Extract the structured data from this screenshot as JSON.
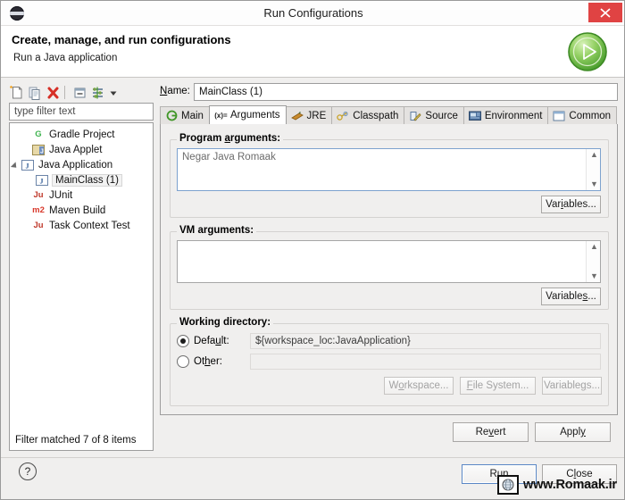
{
  "window": {
    "title": "Run Configurations",
    "app_icon": "eclipse-icon",
    "close_label": "×"
  },
  "header": {
    "title": "Create, manage, and run configurations",
    "subtitle": "Run a Java application",
    "badge_icon": "run-green-play-icon"
  },
  "left_panel": {
    "toolbar": [
      {
        "name": "new-configuration",
        "icon": "new-document-icon"
      },
      {
        "name": "duplicate-configuration",
        "icon": "copy-icon"
      },
      {
        "name": "delete-configuration",
        "icon": "delete-red-x-icon"
      },
      {
        "name": "collapse-all",
        "icon": "collapse-all-icon"
      },
      {
        "name": "filter-configurations",
        "icon": "filter-icon"
      },
      {
        "name": "view-menu",
        "icon": "chevron-down-icon"
      }
    ],
    "filter": {
      "placeholder": "type filter text",
      "value": ""
    },
    "tree": [
      {
        "label": "Gradle Project",
        "icon": "gradle-icon",
        "icon_text": "G",
        "icon_color": "#3fb34f",
        "indent": 12,
        "expandable": false,
        "selected": false
      },
      {
        "label": "Java Applet",
        "icon": "java-applet-icon",
        "icon_text": "J",
        "icon_color": "#c08a2a",
        "indent": 12,
        "expandable": false,
        "selected": false
      },
      {
        "label": "Java Application",
        "icon": "java-app-icon",
        "icon_text": "J",
        "icon_color": "#3a6fb0",
        "indent": 0,
        "expandable": true,
        "selected": false
      },
      {
        "label": "MainClass (1)",
        "icon": "java-app-icon",
        "icon_text": "J",
        "icon_color": "#3a6fb0",
        "indent": 28,
        "expandable": false,
        "selected": true
      },
      {
        "label": "JUnit",
        "icon": "junit-icon",
        "icon_text": "Ju",
        "icon_color": "#c0392b",
        "indent": 12,
        "expandable": false,
        "selected": false
      },
      {
        "label": "Maven Build",
        "icon": "maven-icon",
        "icon_text": "m2",
        "icon_color": "#d8382b",
        "indent": 12,
        "expandable": false,
        "selected": false
      },
      {
        "label": "Task Context Test",
        "icon": "task-context-icon",
        "icon_text": "Ju",
        "icon_color": "#c0392b",
        "indent": 12,
        "expandable": false,
        "selected": false
      }
    ],
    "status": "Filter matched 7 of 8 items"
  },
  "right_panel": {
    "name_label": "Name:",
    "name_label_mnemonic": "N",
    "name_value": "MainClass (1)",
    "tabs": [
      {
        "label": "Main",
        "icon": "main-green-circle-icon",
        "active": false
      },
      {
        "label": "Arguments",
        "icon": "arguments-xy-icon",
        "active": true
      },
      {
        "label": "JRE",
        "icon": "jre-icon",
        "active": false
      },
      {
        "label": "Classpath",
        "icon": "classpath-icon",
        "active": false
      },
      {
        "label": "Source",
        "icon": "source-icon",
        "active": false
      },
      {
        "label": "Environment",
        "icon": "environment-icon",
        "active": false
      },
      {
        "label": "Common",
        "icon": "common-icon",
        "active": false
      }
    ],
    "program_arguments": {
      "label": "Program arguments:",
      "mnemonic": "a",
      "value": "Negar Java Romaak",
      "variables_button": "Variables...",
      "variables_mnemonic": "i"
    },
    "vm_arguments": {
      "label": "VM arguments:",
      "value": "",
      "variables_button": "Variables...",
      "variables_mnemonic": "s"
    },
    "working_directory": {
      "label": "Working directory:",
      "default_option": "Default:",
      "default_mnemonic": "u",
      "default_selected": true,
      "default_value": "${workspace_loc:JavaApplication}",
      "other_option": "Other:",
      "other_mnemonic": "h",
      "other_selected": false,
      "other_value": "",
      "buttons": [
        {
          "label": "Workspace...",
          "mnemonic": "o",
          "disabled": true
        },
        {
          "label": "File System...",
          "mnemonic": "F",
          "disabled": true
        },
        {
          "label": "Variables...",
          "mnemonic": "g",
          "disabled": true
        }
      ]
    },
    "revert_button": "Revert",
    "revert_mnemonic": "v",
    "apply_button": "Apply",
    "apply_mnemonic": "y"
  },
  "footer": {
    "help_icon": "help-question-icon",
    "run_button": "Run",
    "run_mnemonic": "u",
    "close_button": "Close",
    "close_mnemonic": "l"
  },
  "watermark": {
    "text": "www.Romaak.ir",
    "icon": "globe-icon"
  },
  "colors": {
    "close_red": "#e04343",
    "run_green": "#5fb83c",
    "focus_blue": "#7da2ce",
    "dialog_bg": "#f0efee"
  }
}
